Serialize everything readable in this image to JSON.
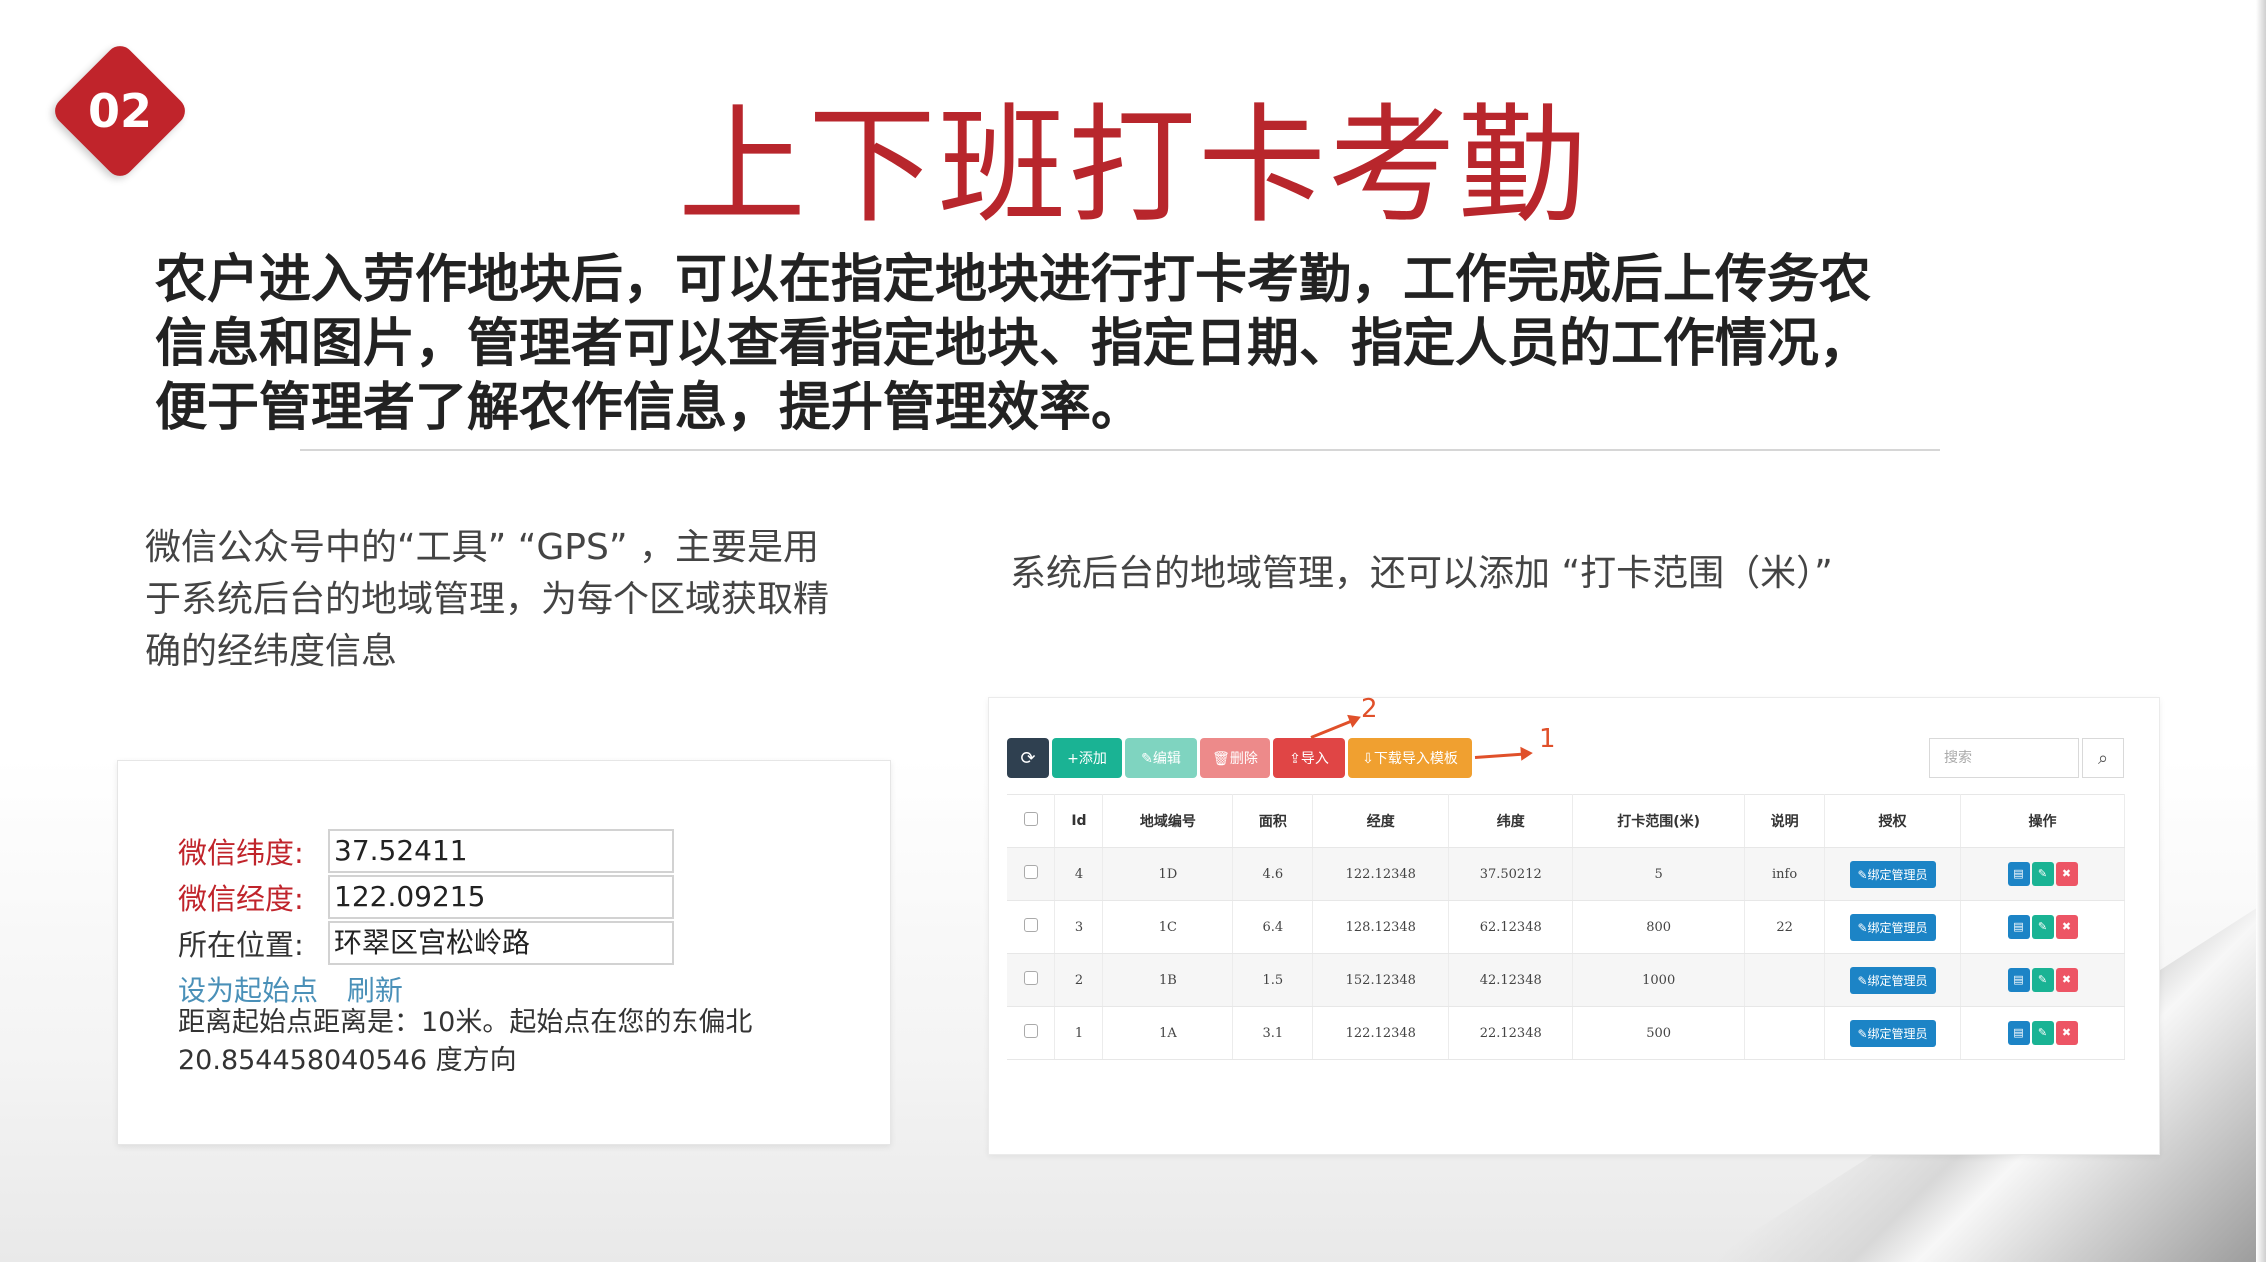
{
  "badge": {
    "number": "02"
  },
  "title": "上下班打卡考勤",
  "intro": "农户进入劳作地块后，可以在指定地块进行打卡考勤，工作完成后上传务农信息和图片，管理者可以查看指定地块、指定日期、指定人员的工作情况，便于管理者了解农作信息，提升管理效率。",
  "left_description": "微信公众号中的“工具” “GPS” ，主要是用于系统后台的地域管理，为每个区域获取精确的经纬度信息",
  "right_description": "系统后台的地域管理，还可以添加 “打卡范围（米）”",
  "wechat_panel": {
    "lat_label": "微信纬度:",
    "lat_value": "37.52411",
    "lng_label": "微信经度:",
    "lng_value": "122.09215",
    "loc_label": "所在位置:",
    "loc_value": "环翠区宫松岭路",
    "set_start_link": "设为起始点",
    "refresh_link": "刷新",
    "distance_text": "距离起始点距离是：10米。起始点在您的东偏北20.854458040546 度方向"
  },
  "admin_panel": {
    "toolbar": {
      "add": "+添加",
      "edit": "✎编辑",
      "delete": "🗑删除",
      "import": "⇪导入",
      "template": "⇩下载导入模板"
    },
    "annotations": {
      "first": "1",
      "second": "2"
    },
    "search_placeholder": "搜索",
    "columns": [
      "Id",
      "地域编号",
      "面积",
      "经度",
      "纬度",
      "打卡范围(米)",
      "说明",
      "授权",
      "操作"
    ],
    "auth_label": "✎绑定管理员",
    "rows": [
      {
        "id": "4",
        "code": "1D",
        "area": "4.6",
        "lng": "122.12348",
        "lat": "37.50212",
        "range": "5",
        "note": "info"
      },
      {
        "id": "3",
        "code": "1C",
        "area": "6.4",
        "lng": "128.12348",
        "lat": "62.12348",
        "range": "800",
        "note": "22"
      },
      {
        "id": "2",
        "code": "1B",
        "area": "1.5",
        "lng": "152.12348",
        "lat": "42.12348",
        "range": "1000",
        "note": ""
      },
      {
        "id": "1",
        "code": "1A",
        "area": "3.1",
        "lng": "122.12348",
        "lat": "22.12348",
        "range": "500",
        "note": ""
      }
    ]
  }
}
